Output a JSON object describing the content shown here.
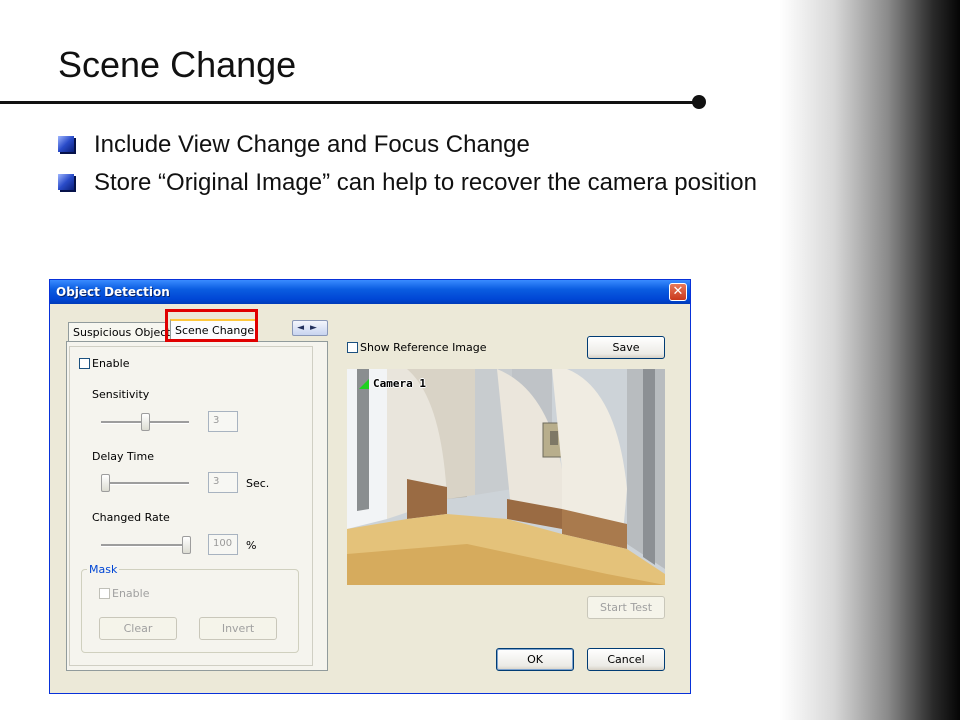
{
  "slide": {
    "title": "Scene Change",
    "bullets": [
      "Include View Change and Focus Change",
      "Store “Original Image” can help to recover the camera position"
    ]
  },
  "dialog": {
    "title": "Object Detection",
    "close_label": "✕",
    "tabs": [
      "Suspicious Object",
      "Scene Change"
    ],
    "active_tab": "Scene Change",
    "tab_scroll": "◄►",
    "enable_label": "Enable",
    "enable_checked": false,
    "sensitivity": {
      "label": "Sensitivity",
      "value": "3",
      "slider_fraction": 0.45
    },
    "delay_time": {
      "label": "Delay  Time",
      "value": "3",
      "unit": "Sec.",
      "slider_fraction": 0.0
    },
    "changed_rate": {
      "label": "Changed Rate",
      "value": "100",
      "unit": "%",
      "slider_fraction": 1.0
    },
    "mask": {
      "title": "Mask",
      "enable_label": "Enable",
      "clear_label": "Clear",
      "invert_label": "Invert"
    },
    "show_reference_label": "Show Reference Image",
    "show_reference_checked": false,
    "save_label": "Save",
    "camera_label": "Camera  1",
    "start_test_label": "Start Test",
    "ok_label": "OK",
    "cancel_label": "Cancel",
    "colors": {
      "titlebar": "#0046d5",
      "highlight": "#e00000",
      "bullet": "#2a4cc9"
    }
  }
}
